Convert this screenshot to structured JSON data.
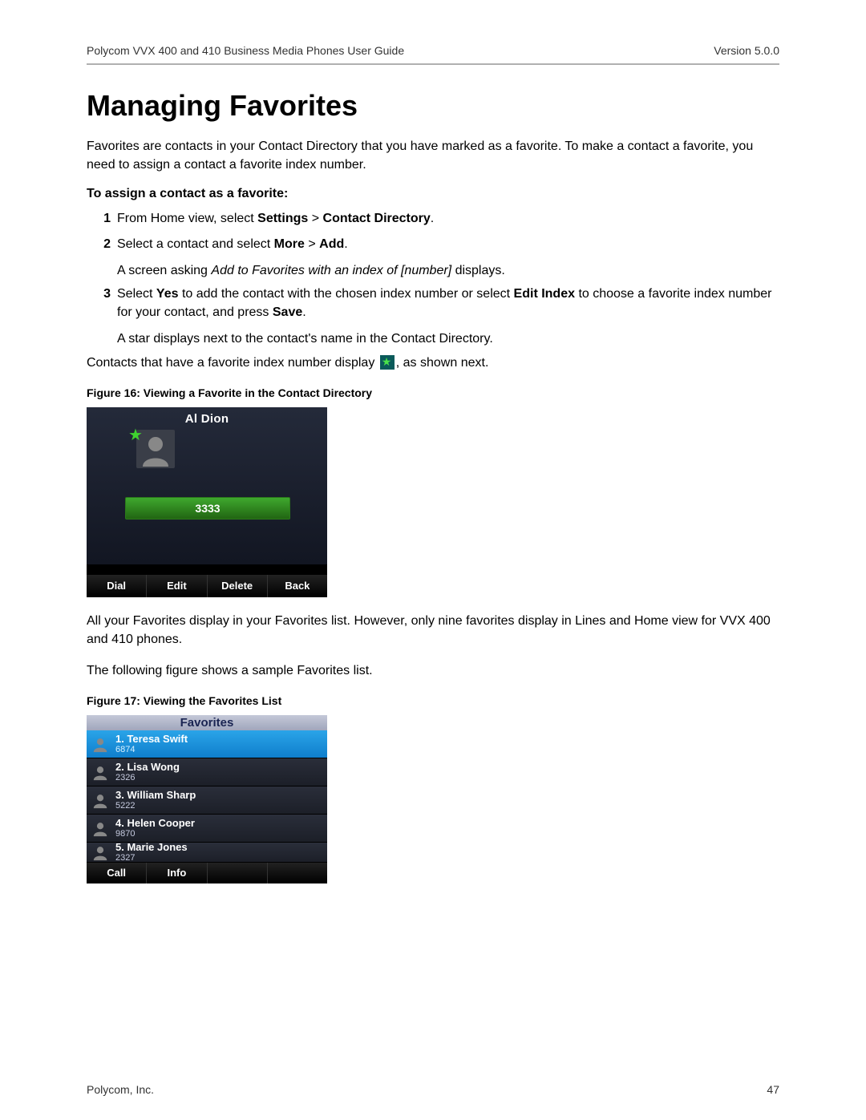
{
  "header": {
    "doc_title": "Polycom VVX 400 and 410 Business Media Phones User Guide",
    "version": "Version 5.0.0"
  },
  "h1": "Managing Favorites",
  "intro": "Favorites are contacts in your Contact Directory that you have marked as a favorite. To make a contact a favorite, you need to assign a contact a favorite index number.",
  "subhead1": "To assign a contact as a favorite:",
  "step1": {
    "num": "1",
    "pre": "From Home view, select ",
    "b1": "Settings",
    "gt": " > ",
    "b2": "Contact Directory",
    "post": "."
  },
  "step2": {
    "num": "2",
    "pre": "Select a contact and select ",
    "b1": "More",
    "gt": " > ",
    "b2": "Add",
    "post": "."
  },
  "step2sub": {
    "pre": "A screen asking ",
    "it": "Add to Favorites with an index of [number]",
    "post": " displays."
  },
  "step3": {
    "num": "3",
    "pre": "Select ",
    "b1": "Yes",
    "mid": " to add the contact with the chosen index number or select ",
    "b2": "Edit Index",
    "mid2": " to choose a favorite index number for your contact, and press ",
    "b3": "Save",
    "post": "."
  },
  "step3sub": "A star displays next to the contact's name in the Contact Directory.",
  "after_steps": {
    "pre": "Contacts that have a favorite index number display ",
    "post": ", as shown next."
  },
  "fig16_caption": "Figure 16: Viewing a Favorite in the Contact Directory",
  "phone1": {
    "name": "Al Dion",
    "number": "3333",
    "softkeys": [
      "Dial",
      "Edit",
      "Delete",
      "Back"
    ]
  },
  "para_after_fig16": "All your Favorites display in your Favorites list. However, only nine favorites display in Lines and Home view for VVX 400 and 410 phones.",
  "para_fig17intro": "The following figure shows a sample Favorites list.",
  "fig17_caption": "Figure 17: Viewing the Favorites List",
  "phone2": {
    "title": "Favorites",
    "rows": [
      {
        "name": "1. Teresa Swift",
        "num": "6874",
        "selected": true
      },
      {
        "name": "2. Lisa Wong",
        "num": "2326"
      },
      {
        "name": "3. William Sharp",
        "num": "5222"
      },
      {
        "name": "4. Helen Cooper",
        "num": "9870"
      },
      {
        "name": "5. Marie Jones",
        "num": "2327",
        "cut": true
      }
    ],
    "softkeys": [
      "Call",
      "Info"
    ]
  },
  "footer": {
    "company": "Polycom, Inc.",
    "page": "47"
  }
}
